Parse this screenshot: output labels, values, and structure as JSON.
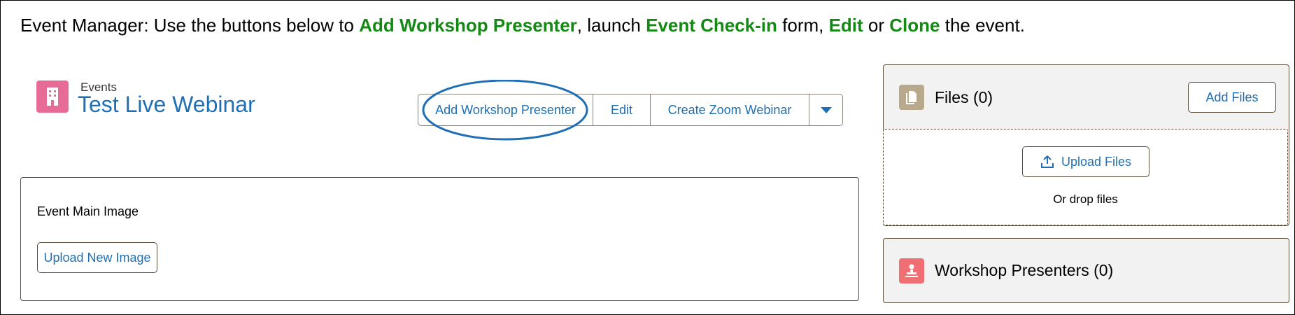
{
  "instruction": {
    "prefix": "Event Manager: Use the buttons below to ",
    "action1": "Add Workshop Presenter",
    "mid1": ", launch ",
    "action2": "Event Check-in",
    "mid2": " form, ",
    "action3": "Edit",
    "mid3": " or ",
    "action4": "Clone",
    "suffix": " the event."
  },
  "record": {
    "icon": "building-icon",
    "type": "Events",
    "title": "Test Live Webinar"
  },
  "actions": {
    "add_presenter": "Add Workshop Presenter",
    "edit": "Edit",
    "create_zoom": "Create Zoom Webinar",
    "more_icon": "chevron-down-icon"
  },
  "main_panel": {
    "label": "Event Main Image",
    "upload_button": "Upload New Image"
  },
  "files": {
    "icon": "file-icon",
    "title": "Files (0)",
    "add_button": "Add Files",
    "upload_button": "Upload Files",
    "drop_text": "Or drop files"
  },
  "presenters": {
    "icon": "presenter-icon",
    "title": "Workshop Presenters (0)"
  },
  "colors": {
    "highlight_green": "#148a14",
    "link_blue": "#1e6fb5",
    "record_icon": "#e66b96",
    "files_icon": "#b8a98c",
    "presenters_icon": "#ef6f72"
  }
}
